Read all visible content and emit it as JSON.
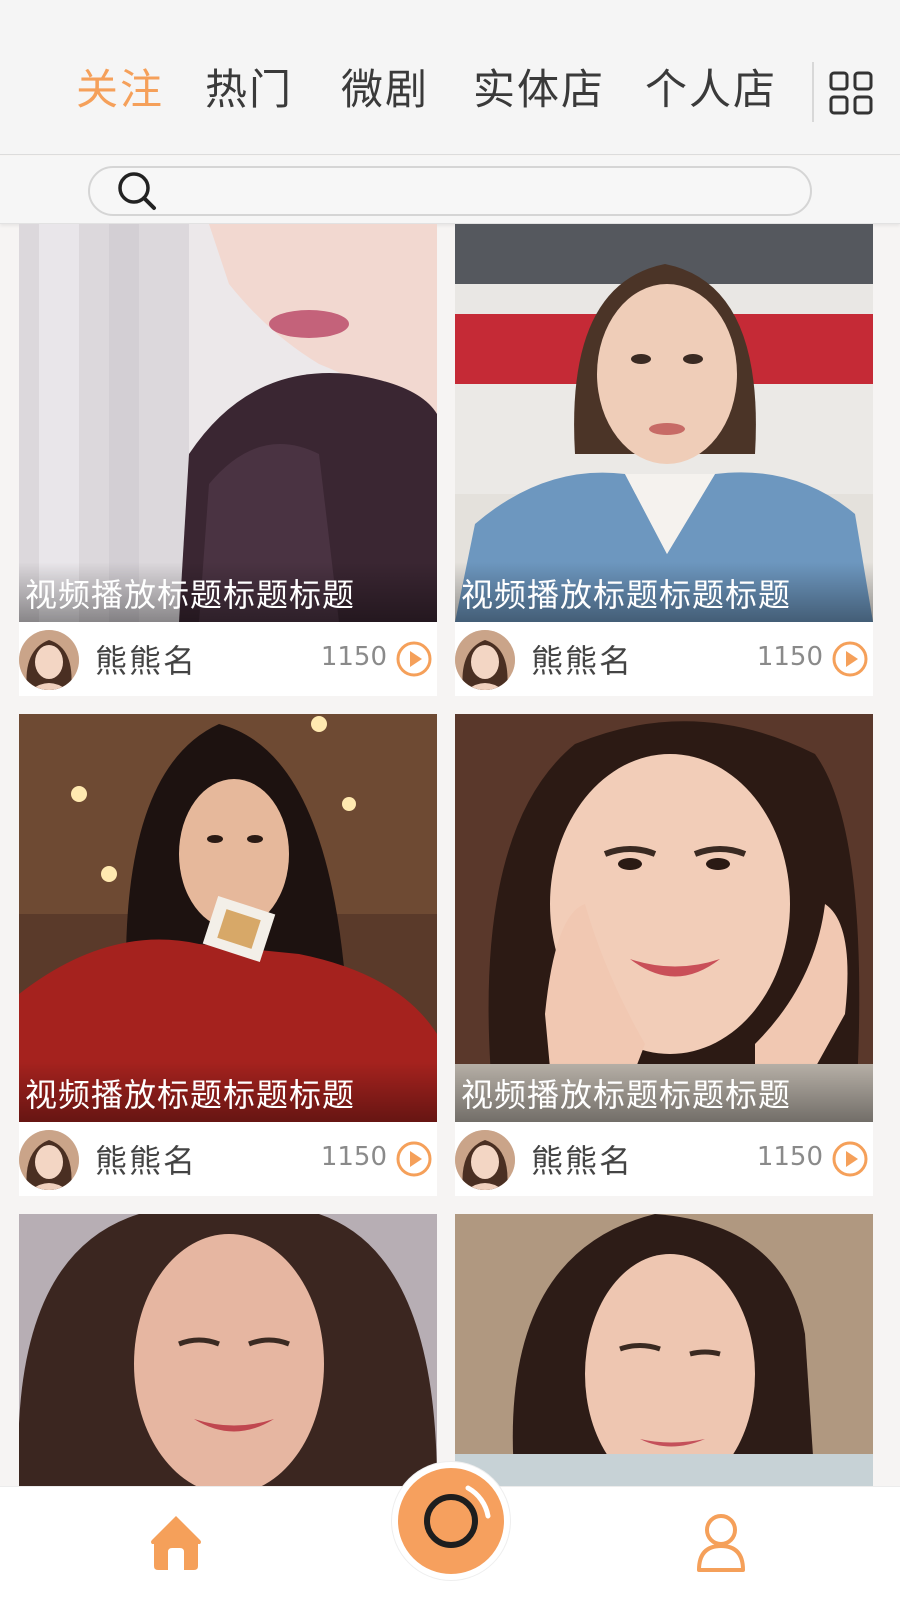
{
  "tabs": {
    "items": [
      {
        "label": "关注",
        "active": true
      },
      {
        "label": "热门",
        "active": false
      },
      {
        "label": "微剧",
        "active": false
      },
      {
        "label": "实体店",
        "active": false
      },
      {
        "label": "个人店",
        "active": false
      }
    ],
    "menu_icon": "grid-icon"
  },
  "search": {
    "placeholder": "",
    "value": "",
    "icon": "search-icon"
  },
  "cards": [
    {
      "title": "视频播放标题标题标题",
      "author": "熊熊名",
      "count": "1150"
    },
    {
      "title": "视频播放标题标题标题",
      "author": "熊熊名",
      "count": "1150"
    },
    {
      "title": "视频播放标题标题标题",
      "author": "熊熊名",
      "count": "1150"
    },
    {
      "title": "视频播放标题标题标题",
      "author": "熊熊名",
      "count": "1150"
    },
    {
      "title": "",
      "author": "",
      "count": ""
    },
    {
      "title": "",
      "author": "",
      "count": ""
    }
  ],
  "bottom_nav": {
    "items": [
      {
        "name": "home",
        "icon": "home-icon"
      },
      {
        "name": "record",
        "icon": "camera-record-icon"
      },
      {
        "name": "profile",
        "icon": "user-icon"
      }
    ]
  },
  "colors": {
    "accent": "#f5a05a",
    "text": "#3a3a3a",
    "background": "#f6f4f3"
  }
}
